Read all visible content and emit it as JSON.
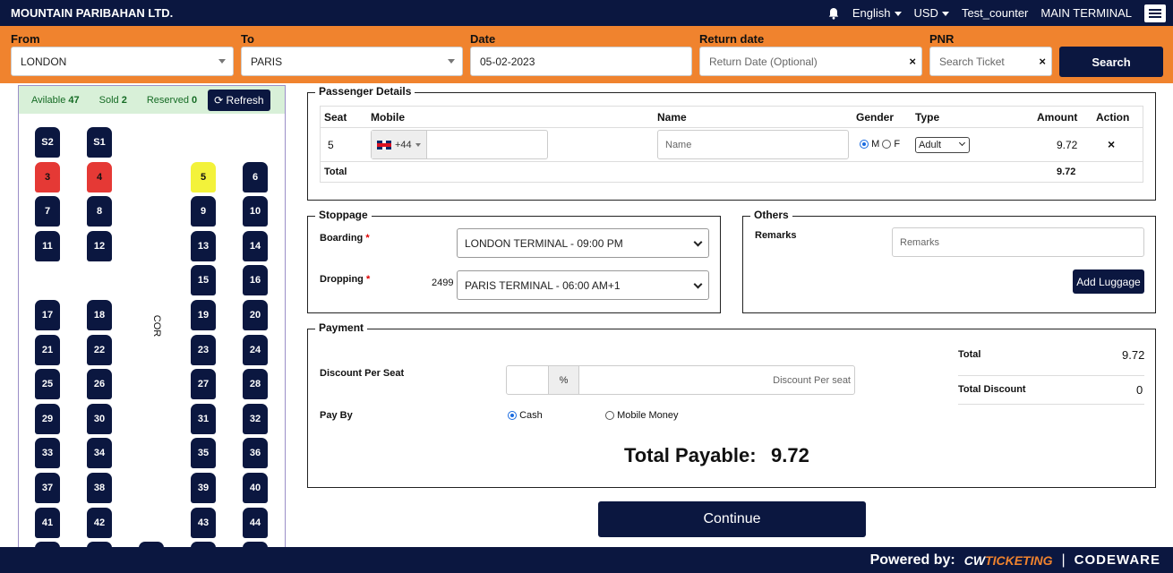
{
  "app": {
    "brand": "MOUNTAIN PARIBAHAN LTD.",
    "language": "English",
    "currency": "USD",
    "user": "Test_counter",
    "terminal": "MAIN TERMINAL"
  },
  "search": {
    "from_label": "From",
    "from_value": "LONDON",
    "to_label": "To",
    "to_value": "PARIS",
    "date_label": "Date",
    "date_value": "05-02-2023",
    "return_label": "Return date",
    "return_placeholder": "Return Date (Optional)",
    "pnr_label": "PNR",
    "pnr_placeholder": "Search Ticket",
    "search_button": "Search",
    "clear": "×"
  },
  "seatmap": {
    "available_label": "Avilable",
    "available_count": "47",
    "sold_label": "Sold",
    "sold_count": "2",
    "reserved_label": "Reserved",
    "reserved_count": "0",
    "refresh_label": "Refresh",
    "corridor_label": "COR",
    "seats": [
      {
        "label": "S2",
        "status": "available",
        "col": 0,
        "row": 0
      },
      {
        "label": "S1",
        "status": "available",
        "col": 1,
        "row": 0
      },
      {
        "label": "3",
        "status": "sold",
        "col": 0,
        "row": 1
      },
      {
        "label": "4",
        "status": "sold",
        "col": 1,
        "row": 1
      },
      {
        "label": "5",
        "status": "selected",
        "col": 3,
        "row": 1
      },
      {
        "label": "6",
        "status": "available",
        "col": 4,
        "row": 1
      },
      {
        "label": "7",
        "status": "available",
        "col": 0,
        "row": 2
      },
      {
        "label": "8",
        "status": "available",
        "col": 1,
        "row": 2
      },
      {
        "label": "9",
        "status": "available",
        "col": 3,
        "row": 2
      },
      {
        "label": "10",
        "status": "available",
        "col": 4,
        "row": 2
      },
      {
        "label": "11",
        "status": "available",
        "col": 0,
        "row": 3
      },
      {
        "label": "12",
        "status": "available",
        "col": 1,
        "row": 3
      },
      {
        "label": "13",
        "status": "available",
        "col": 3,
        "row": 3
      },
      {
        "label": "14",
        "status": "available",
        "col": 4,
        "row": 3
      },
      {
        "label": "15",
        "status": "available",
        "col": 3,
        "row": 4
      },
      {
        "label": "16",
        "status": "available",
        "col": 4,
        "row": 4
      },
      {
        "label": "17",
        "status": "available",
        "col": 0,
        "row": 5
      },
      {
        "label": "18",
        "status": "available",
        "col": 1,
        "row": 5
      },
      {
        "label": "19",
        "status": "available",
        "col": 3,
        "row": 5
      },
      {
        "label": "20",
        "status": "available",
        "col": 4,
        "row": 5
      },
      {
        "label": "21",
        "status": "available",
        "col": 0,
        "row": 6
      },
      {
        "label": "22",
        "status": "available",
        "col": 1,
        "row": 6
      },
      {
        "label": "23",
        "status": "available",
        "col": 3,
        "row": 6
      },
      {
        "label": "24",
        "status": "available",
        "col": 4,
        "row": 6
      },
      {
        "label": "25",
        "status": "available",
        "col": 0,
        "row": 7
      },
      {
        "label": "26",
        "status": "available",
        "col": 1,
        "row": 7
      },
      {
        "label": "27",
        "status": "available",
        "col": 3,
        "row": 7
      },
      {
        "label": "28",
        "status": "available",
        "col": 4,
        "row": 7
      },
      {
        "label": "29",
        "status": "available",
        "col": 0,
        "row": 8
      },
      {
        "label": "30",
        "status": "available",
        "col": 1,
        "row": 8
      },
      {
        "label": "31",
        "status": "available",
        "col": 3,
        "row": 8
      },
      {
        "label": "32",
        "status": "available",
        "col": 4,
        "row": 8
      },
      {
        "label": "33",
        "status": "available",
        "col": 0,
        "row": 9
      },
      {
        "label": "34",
        "status": "available",
        "col": 1,
        "row": 9
      },
      {
        "label": "35",
        "status": "available",
        "col": 3,
        "row": 9
      },
      {
        "label": "36",
        "status": "available",
        "col": 4,
        "row": 9
      },
      {
        "label": "37",
        "status": "available",
        "col": 0,
        "row": 10
      },
      {
        "label": "38",
        "status": "available",
        "col": 1,
        "row": 10
      },
      {
        "label": "39",
        "status": "available",
        "col": 3,
        "row": 10
      },
      {
        "label": "40",
        "status": "available",
        "col": 4,
        "row": 10
      },
      {
        "label": "41",
        "status": "available",
        "col": 0,
        "row": 11
      },
      {
        "label": "42",
        "status": "available",
        "col": 1,
        "row": 11
      },
      {
        "label": "43",
        "status": "available",
        "col": 3,
        "row": 11
      },
      {
        "label": "44",
        "status": "available",
        "col": 4,
        "row": 11
      },
      {
        "label": "",
        "status": "available",
        "col": 0,
        "row": 12
      },
      {
        "label": "",
        "status": "available",
        "col": 1,
        "row": 12
      },
      {
        "label": "",
        "status": "available",
        "col": 2,
        "row": 12
      },
      {
        "label": "",
        "status": "available",
        "col": 3,
        "row": 12
      },
      {
        "label": "",
        "status": "available",
        "col": 4,
        "row": 12
      }
    ]
  },
  "passenger": {
    "legend": "Passenger Details",
    "headers": {
      "seat": "Seat",
      "mobile": "Mobile",
      "name": "Name",
      "gender": "Gender",
      "type": "Type",
      "amount": "Amount",
      "action": "Action"
    },
    "row": {
      "seat": "5",
      "dial_code": "+44",
      "name_placeholder": "Name",
      "gender_m": "M",
      "gender_f": "F",
      "type": "Adult",
      "amount": "9.72",
      "remove": "×"
    },
    "total_label": "Total",
    "total_amount": "9.72"
  },
  "stoppage": {
    "legend": "Stoppage",
    "boarding_label": "Boarding",
    "boarding_value": "LONDON TERMINAL - 09:00 PM",
    "dropping_label": "Dropping",
    "dropping_code": "2499",
    "dropping_value": "PARIS TERMINAL - 06:00 AM+1",
    "required": "*"
  },
  "others": {
    "legend": "Others",
    "remarks_label": "Remarks",
    "remarks_placeholder": "Remarks",
    "luggage_button": "Add Luggage"
  },
  "payment": {
    "legend": "Payment",
    "discount_label": "Discount Per Seat",
    "percent": "%",
    "discount_placeholder": "Discount Per seat",
    "pay_by_label": "Pay By",
    "cash": "Cash",
    "mobile_money": "Mobile Money",
    "total_label": "Total",
    "total_value": "9.72",
    "total_discount_label": "Total Discount",
    "total_discount_value": "0",
    "payable_label": "Total Payable:",
    "payable_value": "9.72"
  },
  "continue_button": "Continue",
  "footer": {
    "powered": "Powered by:",
    "logo_a": "CW",
    "logo_b": "TICKETING",
    "sep": "|",
    "logo_c": "CODEWARE"
  }
}
